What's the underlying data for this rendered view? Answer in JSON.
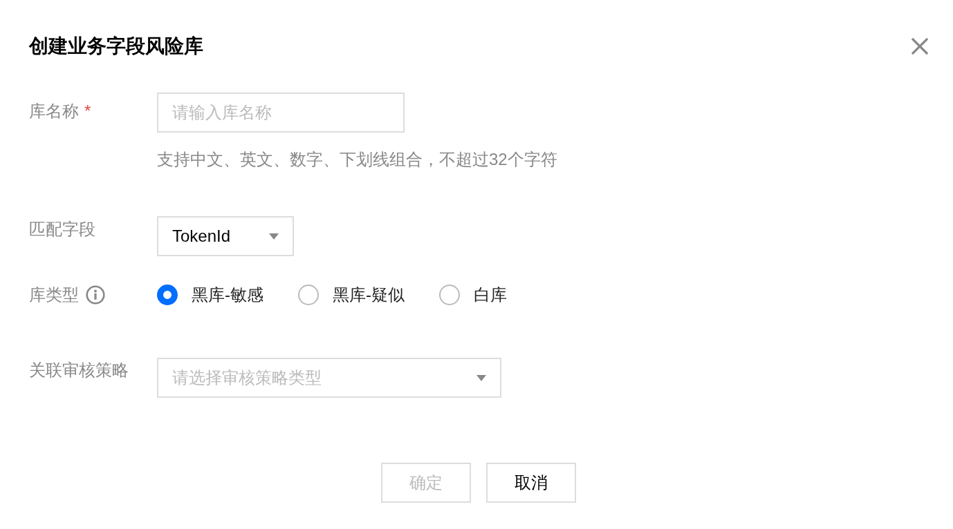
{
  "dialog": {
    "title": "创建业务字段风险库"
  },
  "form": {
    "library_name": {
      "label": "库名称",
      "required_mark": "*",
      "placeholder": "请输入库名称",
      "hint": "支持中文、英文、数字、下划线组合，不超过32个字符"
    },
    "match_field": {
      "label": "匹配字段",
      "value": "TokenId"
    },
    "library_type": {
      "label": "库类型",
      "options": [
        {
          "label": "黑库-敏感",
          "selected": true
        },
        {
          "label": "黑库-疑似",
          "selected": false
        },
        {
          "label": "白库",
          "selected": false
        }
      ]
    },
    "review_policy": {
      "label": "关联审核策略",
      "placeholder": "请选择审核策略类型"
    }
  },
  "buttons": [
    {
      "label": "确定",
      "disabled": true
    },
    {
      "label": "取消",
      "disabled": false
    }
  ]
}
